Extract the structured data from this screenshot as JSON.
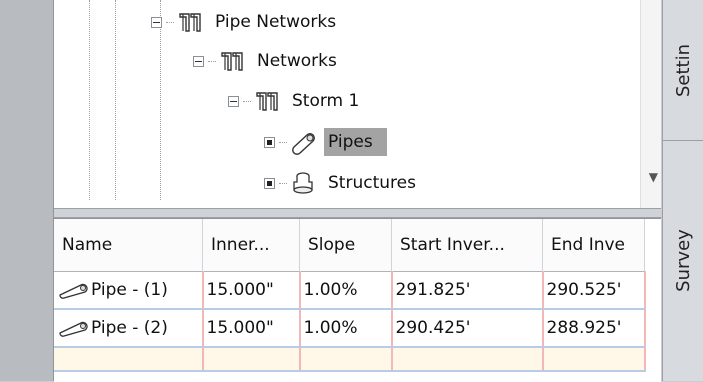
{
  "tree": {
    "nodes": [
      {
        "label": "Pipe Networks",
        "icon": "pipe-network-icon",
        "expander": "minus"
      },
      {
        "label": "Networks",
        "icon": "pipe-network-icon",
        "expander": "minus"
      },
      {
        "label": "Storm 1",
        "icon": "pipe-network-icon",
        "expander": "minus"
      },
      {
        "label": "Pipes",
        "icon": "pipe-icon",
        "expander": "dot",
        "selected": true
      },
      {
        "label": "Structures",
        "icon": "structure-icon",
        "expander": "dot"
      }
    ]
  },
  "grid": {
    "headers": [
      "Name",
      "Inner...",
      "Slope",
      "Start Inver...",
      "End Inve"
    ],
    "rows": [
      [
        "Pipe - (1)",
        "15.000\"",
        "1.00%",
        "291.825'",
        "290.525'"
      ],
      [
        "Pipe - (2)",
        "15.000\"",
        "1.00%",
        "290.425'",
        "288.925'"
      ]
    ]
  },
  "side_tabs": [
    "Settin",
    "Survey"
  ],
  "colors": {
    "selection": "#a3a3a3",
    "grid_vertical": "#f2b8b8",
    "grid_horizontal": "#b9cce6",
    "empty_row": "#fff8e8"
  }
}
